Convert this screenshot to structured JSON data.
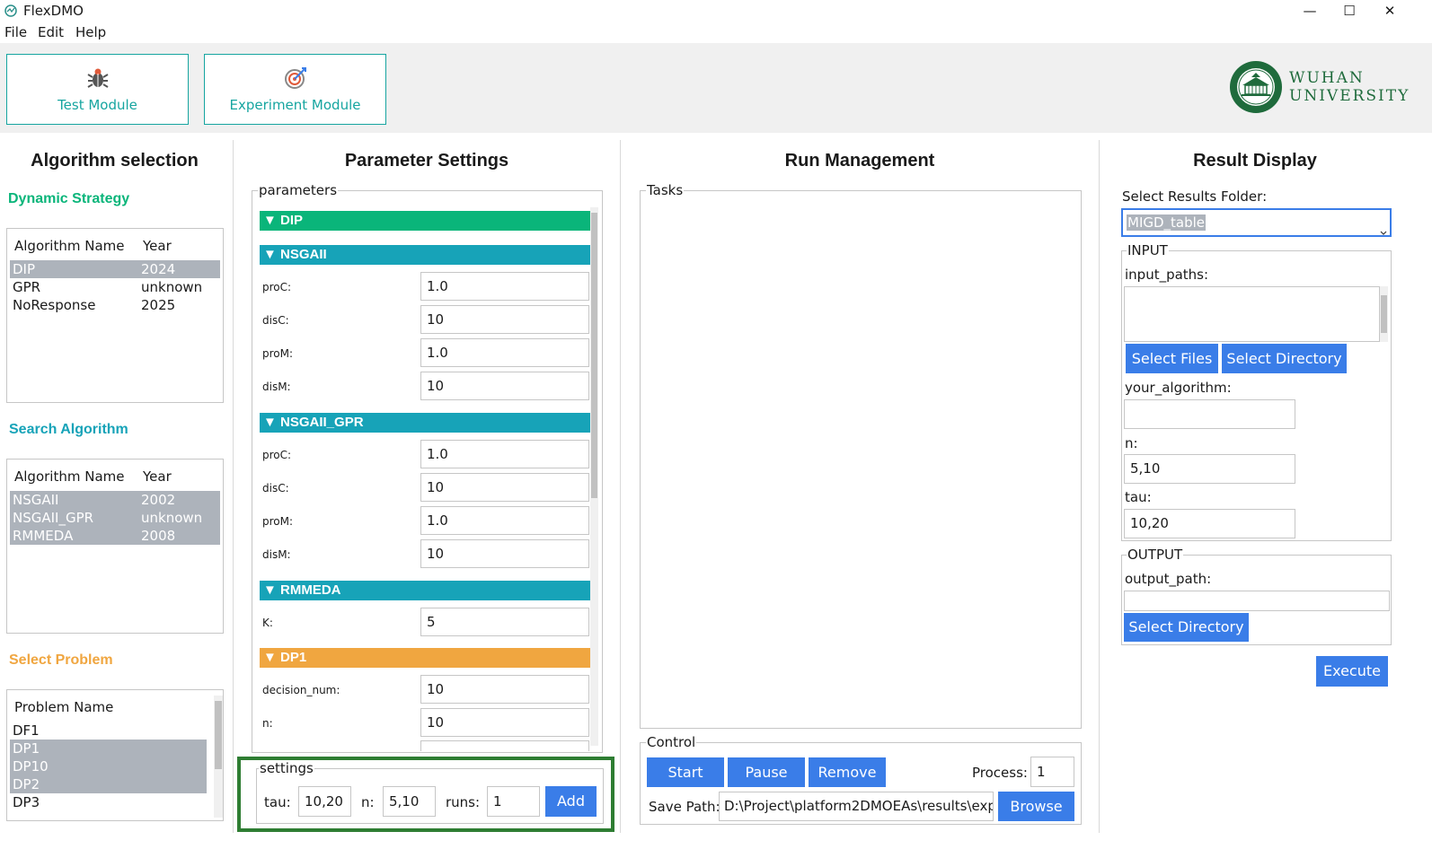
{
  "window": {
    "title": "FlexDMO",
    "minimize": "—",
    "maximize": "☐",
    "close": "✕"
  },
  "menu": [
    "File",
    "Edit",
    "Help"
  ],
  "toolbar": {
    "test_module": "Test Module",
    "experiment_module": "Experiment Module"
  },
  "logo": {
    "line1": "WUHAN",
    "line2": "UNIVERSITY"
  },
  "colors": {
    "accent_teal": "#16a5a0",
    "green": "#0ab57a",
    "teal": "#17a3b8",
    "orange": "#f0a640",
    "blue": "#3a7de8",
    "selection": "#adb3bb",
    "highlight_box": "#2e7d32"
  },
  "algorithm_panel": {
    "title": "Algorithm selection",
    "dynamic_strategy": {
      "label": "Dynamic Strategy",
      "headers": [
        "Algorithm Name",
        "Year"
      ],
      "rows": [
        {
          "name": "DIP",
          "year": "2024",
          "selected": true
        },
        {
          "name": "GPR",
          "year": "unknown",
          "selected": false
        },
        {
          "name": "NoResponse",
          "year": "2025",
          "selected": false
        }
      ]
    },
    "search_algorithm": {
      "label": "Search Algorithm",
      "headers": [
        "Algorithm Name",
        "Year"
      ],
      "rows": [
        {
          "name": "NSGAII",
          "year": "2002",
          "selected": true
        },
        {
          "name": "NSGAII_GPR",
          "year": "unknown",
          "selected": true
        },
        {
          "name": "RMMEDA",
          "year": "2008",
          "selected": true
        }
      ]
    },
    "select_problem": {
      "label": "Select Problem",
      "header": "Problem Name",
      "rows": [
        {
          "name": "DF1",
          "selected": false
        },
        {
          "name": "DP1",
          "selected": true
        },
        {
          "name": "DP10",
          "selected": true
        },
        {
          "name": "DP2",
          "selected": true
        },
        {
          "name": "DP3",
          "selected": false
        }
      ]
    }
  },
  "parameter_panel": {
    "title": "Parameter Settings",
    "parameters_label": "parameters",
    "sections": [
      {
        "name": "▼ DIP",
        "color": "#0ab57a",
        "params": []
      },
      {
        "name": "▼ NSGAII",
        "color": "#17a3b8",
        "params": [
          {
            "label": "proC:",
            "value": "1.0"
          },
          {
            "label": "disC:",
            "value": "10"
          },
          {
            "label": "proM:",
            "value": "1.0"
          },
          {
            "label": "disM:",
            "value": "10"
          }
        ]
      },
      {
        "name": "▼ NSGAII_GPR",
        "color": "#17a3b8",
        "params": [
          {
            "label": "proC:",
            "value": "1.0"
          },
          {
            "label": "disC:",
            "value": "10"
          },
          {
            "label": "proM:",
            "value": "1.0"
          },
          {
            "label": "disM:",
            "value": "10"
          }
        ]
      },
      {
        "name": "▼ RMMEDA",
        "color": "#17a3b8",
        "params": [
          {
            "label": "K:",
            "value": "5"
          }
        ]
      },
      {
        "name": "▼ DP1",
        "color": "#f0a640",
        "params": [
          {
            "label": "decision_num:",
            "value": "10"
          },
          {
            "label": "n:",
            "value": "10"
          }
        ]
      }
    ],
    "settings": {
      "label": "settings",
      "tau_label": "tau:",
      "tau_value": "10,20",
      "n_label": "n:",
      "n_value": "5,10",
      "runs_label": "runs:",
      "runs_value": "1",
      "add": "Add"
    }
  },
  "run_panel": {
    "title": "Run Management",
    "tasks_label": "Tasks",
    "control_label": "Control",
    "start": "Start",
    "pause": "Pause",
    "remove": "Remove",
    "process_label": "Process:",
    "process_value": "1",
    "save_path_label": "Save Path:",
    "save_path_value": "D:\\Project\\platform2DMOEAs\\results\\exp",
    "browse": "Browse"
  },
  "result_panel": {
    "title": "Result Display",
    "folder_label": "Select Results Folder:",
    "folder_value": "MIGD_table",
    "input_label": "INPUT",
    "input_paths_label": "input_paths:",
    "select_files": "Select Files",
    "select_directory": "Select Directory",
    "your_algorithm_label": "your_algorithm:",
    "your_algorithm_value": "",
    "n_label": "n:",
    "n_value": "5,10",
    "tau_label": "tau:",
    "tau_value": "10,20",
    "output_label": "OUTPUT",
    "output_path_label": "output_path:",
    "output_path_value": "",
    "output_select_directory": "Select Directory",
    "execute": "Execute"
  }
}
